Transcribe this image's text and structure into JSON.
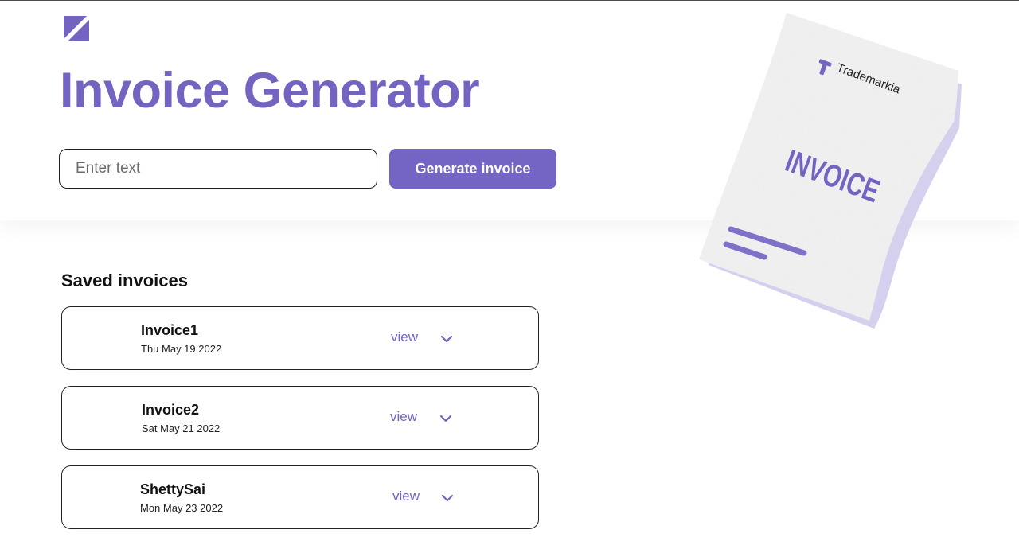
{
  "header": {
    "title": "Invoice Generator"
  },
  "search": {
    "placeholder": "Enter text",
    "value": ""
  },
  "actions": {
    "generate_label": "Generate invoice"
  },
  "saved": {
    "heading": "Saved invoices",
    "items": [
      {
        "name": "Invoice1",
        "date": "Thu May 19 2022",
        "view_label": "view"
      },
      {
        "name": "Invoice2",
        "date": "Sat May 21 2022",
        "view_label": "view"
      },
      {
        "name": "ShettySai",
        "date": "Mon May 23 2022",
        "view_label": "view"
      }
    ]
  },
  "illustration": {
    "brand": "Trademarkia",
    "doc_label": "INVOICE"
  },
  "colors": {
    "accent": "#7563c2",
    "button": "#7464c3",
    "illustration_shadow": "#d6d0ef"
  },
  "icons": {
    "logo": "app-logo-icon",
    "expand": "chevron-down-icon"
  }
}
